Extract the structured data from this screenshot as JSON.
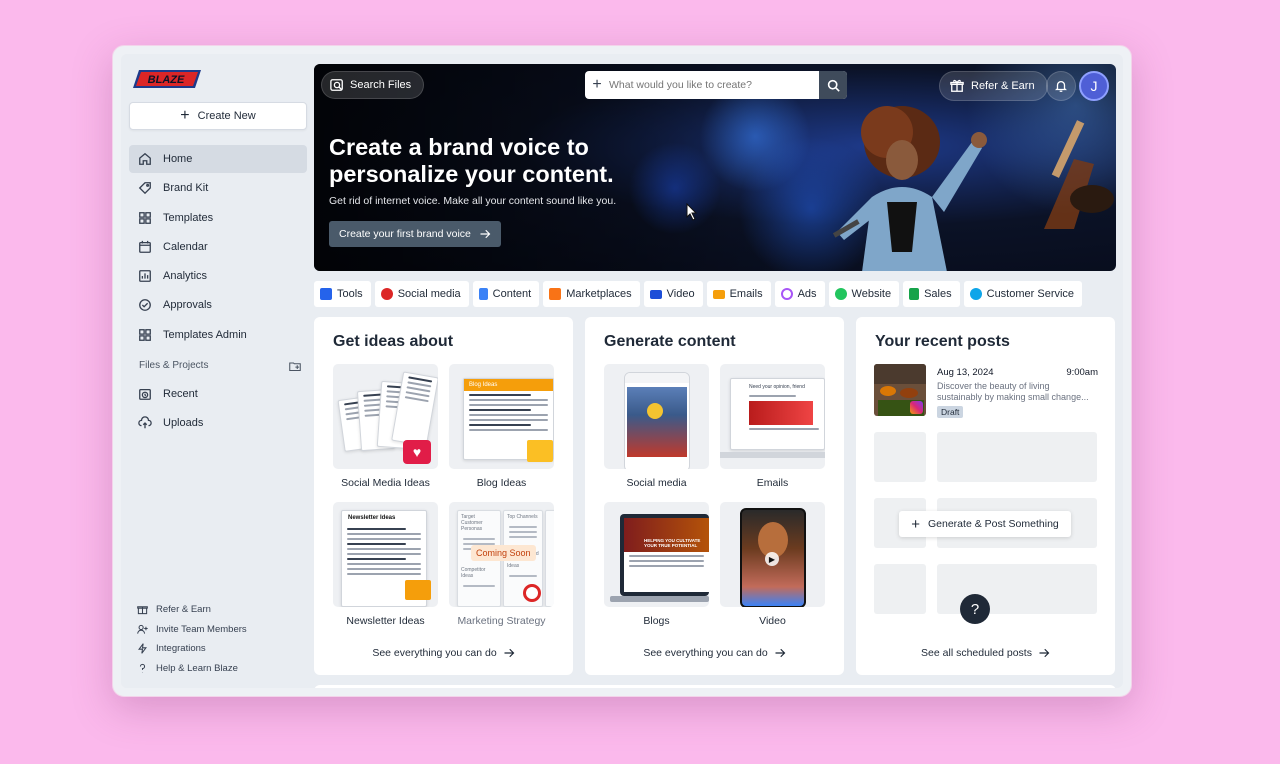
{
  "brand": {
    "logo_text": "BLAZE"
  },
  "sidebar": {
    "create_new": "Create New",
    "items": [
      {
        "label": "Home",
        "icon": "home-icon"
      },
      {
        "label": "Brand Kit",
        "icon": "tag-icon"
      },
      {
        "label": "Templates",
        "icon": "grid-icon"
      },
      {
        "label": "Calendar",
        "icon": "calendar-icon"
      },
      {
        "label": "Analytics",
        "icon": "chart-icon"
      },
      {
        "label": "Approvals",
        "icon": "check-circle-icon"
      },
      {
        "label": "Templates Admin",
        "icon": "grid-icon"
      }
    ],
    "files_heading": "Files & Projects",
    "files_items": [
      {
        "label": "Recent",
        "icon": "clock-icon"
      },
      {
        "label": "Uploads",
        "icon": "upload-icon"
      }
    ],
    "footer": [
      {
        "label": "Refer & Earn",
        "icon": "gift-icon"
      },
      {
        "label": "Invite Team Members",
        "icon": "user-plus-icon"
      },
      {
        "label": "Integrations",
        "icon": "bolt-icon"
      },
      {
        "label": "Help & Learn Blaze",
        "icon": "question-icon"
      }
    ]
  },
  "header": {
    "search_files": "Search Files",
    "search_placeholder": "What would you like to create?",
    "refer": "Refer & Earn",
    "avatar_initial": "J"
  },
  "hero": {
    "title": "Create a brand voice to personalize your content.",
    "subtitle": "Get rid of internet voice. Make all your content sound like you.",
    "cta": "Create your first brand voice"
  },
  "tabs": [
    {
      "label": "Tools",
      "color": "#2563eb"
    },
    {
      "label": "Social media",
      "color": "#dc2626"
    },
    {
      "label": "Content",
      "color": "#3b82f6"
    },
    {
      "label": "Marketplaces",
      "color": "#f97316"
    },
    {
      "label": "Video",
      "color": "#1d4ed8"
    },
    {
      "label": "Emails",
      "color": "#f59e0b"
    },
    {
      "label": "Ads",
      "color": "#a855f7"
    },
    {
      "label": "Website",
      "color": "#22c55e"
    },
    {
      "label": "Sales",
      "color": "#16a34a"
    },
    {
      "label": "Customer Service",
      "color": "#0ea5e9"
    }
  ],
  "ideas": {
    "title": "Get ideas about",
    "tiles": [
      "Social Media Ideas",
      "Blog Ideas",
      "Newsletter Ideas",
      "Marketing Strategy"
    ],
    "blog_banner": "Blog Ideas",
    "newsletter_banner": "Newsletter Ideas",
    "coming_soon": "Coming Soon",
    "strategy_labels": [
      "Target Customer Personas",
      "Top Channels",
      "Competitor Ideas",
      "Marketing and Promotion Ideas"
    ],
    "see_all": "See everything you can do"
  },
  "generate": {
    "title": "Generate content",
    "tiles": [
      "Social media",
      "Emails",
      "Blogs",
      "Video"
    ],
    "email_heading": "Need your opinion, friend",
    "blog_heading": "HELPING YOU CULTIVATE YOUR TRUE POTENTIAL",
    "see_all": "See everything you can do"
  },
  "recent": {
    "title": "Your recent posts",
    "post": {
      "date": "Aug 13, 2024",
      "time": "9:00am",
      "text": "Discover the beauty of living sustainably by making small change...",
      "status": "Draft"
    },
    "generate_btn": "Generate & Post Something",
    "see_all": "See all scheduled posts"
  },
  "help": "?"
}
